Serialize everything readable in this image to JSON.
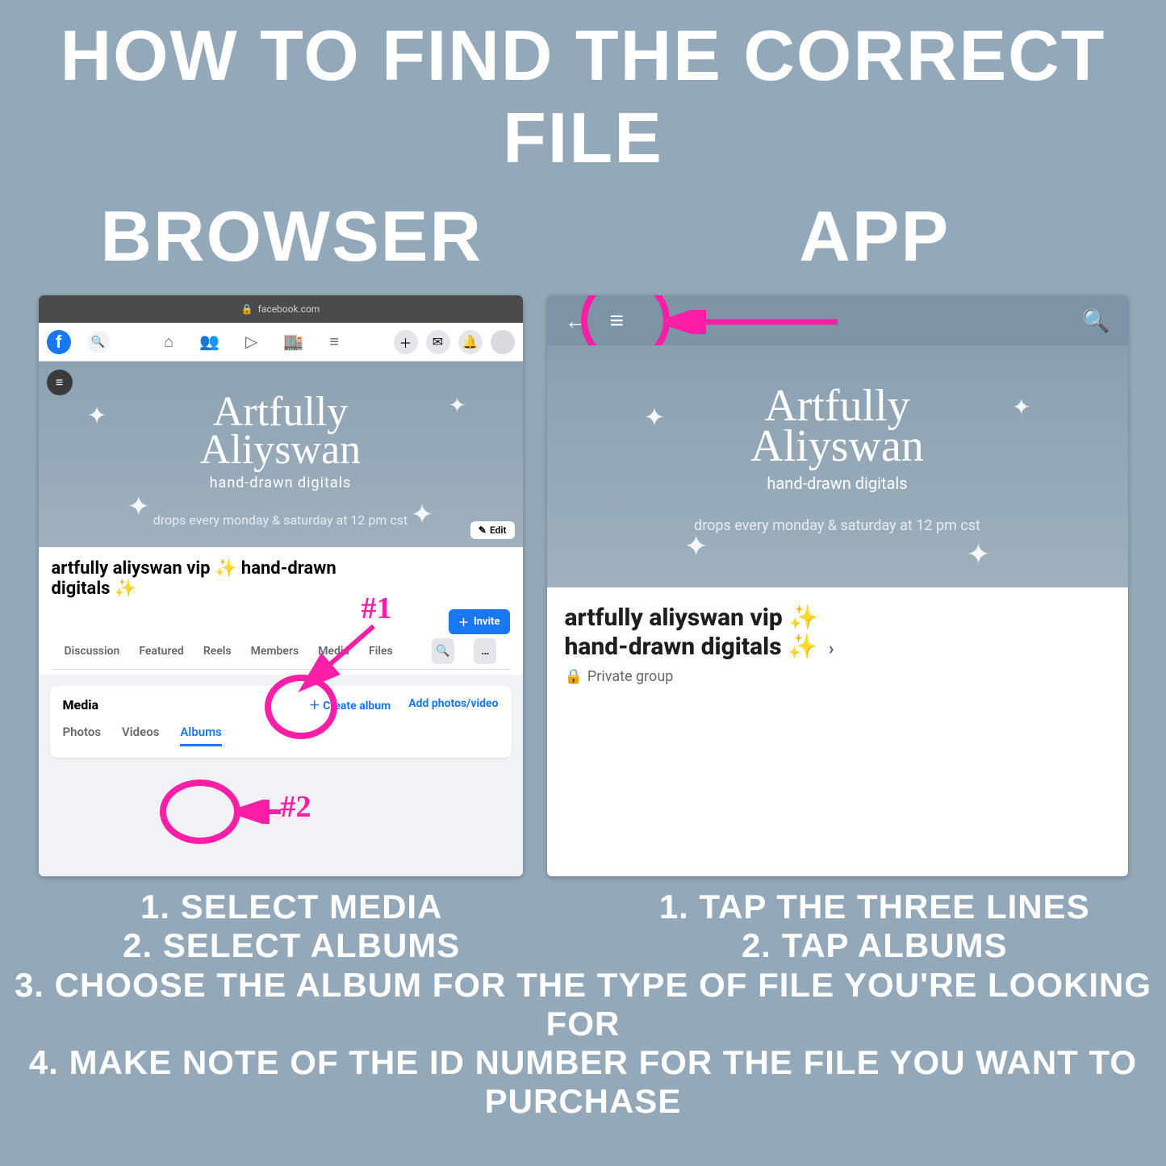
{
  "headline": "HOW TO FIND THE CORRECT FILE",
  "subhead_browser": "BROWSER",
  "subhead_app": "APP",
  "browser": {
    "url_host": "facebook.com",
    "cover": {
      "brand_line1": "Artfully",
      "brand_line2": "Aliyswan",
      "subtitle": "hand-drawn digitals",
      "drops": "drops every monday & saturday at 12 pm cst",
      "edit": "Edit"
    },
    "group_title_a": "artfully aliyswan vip ✨ hand-drawn",
    "group_title_b": "digitals ✨",
    "invite": "Invite",
    "tabs": [
      "Discussion",
      "Featured",
      "Reels",
      "Members",
      "Media",
      "Files"
    ],
    "media": {
      "title": "Media",
      "create": "Create album",
      "add": "Add photos/video",
      "subtabs": [
        "Photos",
        "Videos",
        "Albums"
      ]
    },
    "anno1": "#1",
    "anno2": "#2"
  },
  "app": {
    "cover": {
      "brand_line1": "Artfully",
      "brand_line2": "Aliyswan",
      "subtitle": "hand-drawn digitals",
      "drops": "drops every monday & saturday at 12 pm cst"
    },
    "title_a": "artfully aliyswan vip ✨",
    "title_b": "hand-drawn digitals ✨",
    "private": "Private group"
  },
  "instructions": {
    "browser": [
      "1. SELECT MEDIA",
      "2. SELECT ALBUMS"
    ],
    "app": [
      "1. TAP THE THREE LINES",
      "2. TAP ALBUMS"
    ],
    "shared": [
      "3. CHOOSE THE ALBUM FOR THE TYPE OF FILE YOU'RE LOOKING FOR",
      "4. MAKE NOTE OF THE ID NUMBER FOR THE FILE YOU WANT TO PURCHASE"
    ]
  }
}
